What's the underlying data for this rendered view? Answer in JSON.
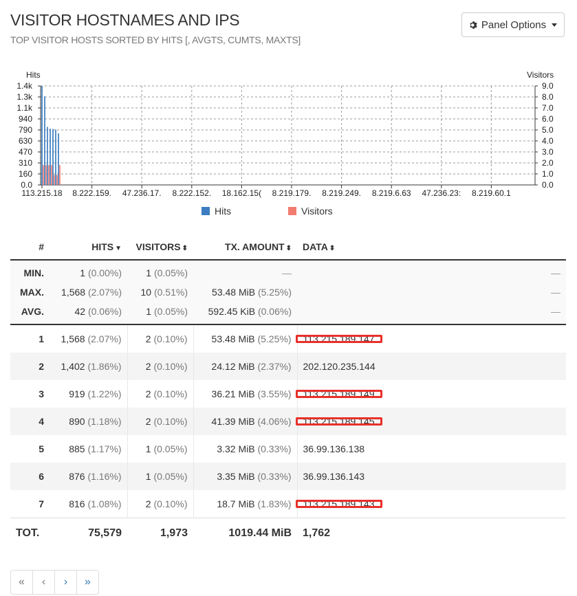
{
  "header": {
    "title": "VISITOR HOSTNAMES AND IPS",
    "subtitle": "TOP VISITOR HOSTS SORTED BY HITS [, AVGTS, CUMTS, MAXTS]",
    "panel_options_label": "Panel Options",
    "panel_options_icon": "gear-icon"
  },
  "colors": {
    "hits": "#3b7dc0",
    "visitors": "#f17b6e",
    "highlight": "#e8302a",
    "link": "#337ab7"
  },
  "chart_data": {
    "type": "bar",
    "left_axis_label": "Hits",
    "right_axis_label": "Visitors",
    "left_ticks": [
      "0.0",
      "160",
      "310",
      "470",
      "630",
      "790",
      "940",
      "1.1k",
      "1.3k",
      "1.4k"
    ],
    "right_ticks": [
      "0.0",
      "1.0",
      "2.0",
      "3.0",
      "4.0",
      "5.0",
      "6.0",
      "7.0",
      "8.0",
      "9.0"
    ],
    "x_ticks": [
      "113.215.18",
      "8.222.159.",
      "47.236.17.",
      "8.222.152.",
      "18.162.15(",
      "8.219.179.",
      "8.219.249.",
      "8.219.6.63",
      "47.236.23:",
      "8.219.60.1"
    ],
    "ylim_left": [
      0,
      1568
    ],
    "ylim_right": [
      0,
      10
    ],
    "series": [
      {
        "name": "Hits",
        "values": [
          1568,
          1402,
          919,
          890,
          885,
          876,
          816
        ]
      },
      {
        "name": "Visitors",
        "values": [
          2,
          2,
          2,
          2,
          1,
          1,
          2
        ]
      }
    ],
    "legend": [
      "Hits",
      "Visitors"
    ],
    "legend_position": "bottom",
    "grid": true
  },
  "table": {
    "columns": [
      {
        "label": "#"
      },
      {
        "label": "HITS",
        "sort": "▼"
      },
      {
        "label": "VISITORS",
        "sort": "⬍"
      },
      {
        "label": "TX. AMOUNT",
        "sort": "⬍"
      },
      {
        "label": "DATA",
        "sort": "⬍"
      }
    ],
    "summary": [
      {
        "label": "MIN.",
        "hits": "1",
        "hits_pct": "(0.00%)",
        "visitors": "1",
        "visitors_pct": "(0.05%)",
        "tx": "—",
        "tx_pct": "",
        "data": "—"
      },
      {
        "label": "MAX.",
        "hits": "1,568",
        "hits_pct": "(2.07%)",
        "visitors": "10",
        "visitors_pct": "(0.51%)",
        "tx": "53.48 MiB",
        "tx_pct": "(5.25%)",
        "data": "—"
      },
      {
        "label": "AVG.",
        "hits": "42",
        "hits_pct": "(0.06%)",
        "visitors": "1",
        "visitors_pct": "(0.05%)",
        "tx": "592.45 KiB",
        "tx_pct": "(0.06%)",
        "data": "—"
      }
    ],
    "rows": [
      {
        "rank": "1",
        "hits": "1,568",
        "hits_pct": "(2.07%)",
        "visitors": "2",
        "visitors_pct": "(0.10%)",
        "tx": "53.48 MiB",
        "tx_pct": "(5.25%)",
        "data": "113.215.189.147",
        "highlighted": true
      },
      {
        "rank": "2",
        "hits": "1,402",
        "hits_pct": "(1.86%)",
        "visitors": "2",
        "visitors_pct": "(0.10%)",
        "tx": "24.12 MiB",
        "tx_pct": "(2.37%)",
        "data": "202.120.235.144",
        "highlighted": false
      },
      {
        "rank": "3",
        "hits": "919",
        "hits_pct": "(1.22%)",
        "visitors": "2",
        "visitors_pct": "(0.10%)",
        "tx": "36.21 MiB",
        "tx_pct": "(3.55%)",
        "data": "113.215.189.149",
        "highlighted": true
      },
      {
        "rank": "4",
        "hits": "890",
        "hits_pct": "(1.18%)",
        "visitors": "2",
        "visitors_pct": "(0.10%)",
        "tx": "41.39 MiB",
        "tx_pct": "(4.06%)",
        "data": "113.215.189.145",
        "highlighted": true
      },
      {
        "rank": "5",
        "hits": "885",
        "hits_pct": "(1.17%)",
        "visitors": "1",
        "visitors_pct": "(0.05%)",
        "tx": "3.32 MiB",
        "tx_pct": "(0.33%)",
        "data": "36.99.136.138",
        "highlighted": false
      },
      {
        "rank": "6",
        "hits": "876",
        "hits_pct": "(1.16%)",
        "visitors": "1",
        "visitors_pct": "(0.05%)",
        "tx": "3.35 MiB",
        "tx_pct": "(0.33%)",
        "data": "36.99.136.143",
        "highlighted": false
      },
      {
        "rank": "7",
        "hits": "816",
        "hits_pct": "(1.08%)",
        "visitors": "2",
        "visitors_pct": "(0.10%)",
        "tx": "18.7 MiB",
        "tx_pct": "(1.83%)",
        "data": "113.215.189.143",
        "highlighted": true
      }
    ],
    "total": {
      "label": "TOT.",
      "hits": "75,579",
      "visitors": "1,973",
      "tx": "1019.44 MiB",
      "data": "1,762"
    }
  },
  "pagination": [
    {
      "label": "«",
      "name": "first-page-button",
      "disabled": true
    },
    {
      "label": "‹",
      "name": "prev-page-button",
      "disabled": true
    },
    {
      "label": "›",
      "name": "next-page-button",
      "disabled": false
    },
    {
      "label": "»",
      "name": "last-page-button",
      "disabled": false
    }
  ]
}
